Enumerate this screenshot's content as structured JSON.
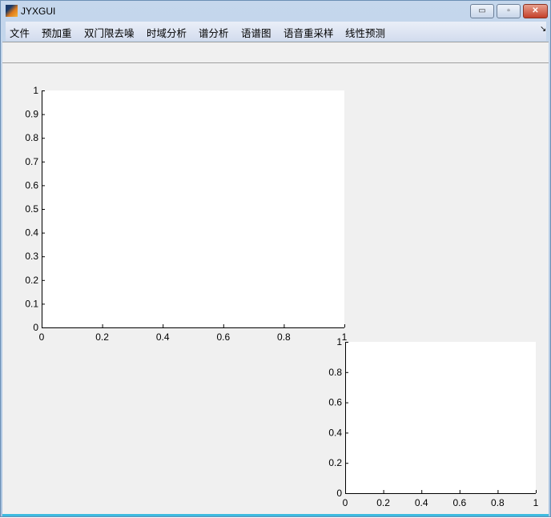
{
  "window": {
    "title": "JYXGUI",
    "minimize": "▭",
    "maximize": "▫",
    "close": "✕"
  },
  "menu": [
    "文件",
    "预加重",
    "双门限去噪",
    "时域分析",
    "谱分析",
    "语谱图",
    "语音重采样",
    "线性预测"
  ],
  "menu_overflow": "↘",
  "chart_data": [
    {
      "type": "line",
      "title": "",
      "xlabel": "",
      "ylabel": "",
      "xlim": [
        0,
        1
      ],
      "ylim": [
        0,
        1
      ],
      "xticks": [
        "0",
        "0.2",
        "0.4",
        "0.6",
        "0.8",
        "1"
      ],
      "yticks": [
        "0",
        "0.1",
        "0.2",
        "0.3",
        "0.4",
        "0.5",
        "0.6",
        "0.7",
        "0.8",
        "0.9",
        "1"
      ],
      "series": []
    },
    {
      "type": "line",
      "title": "",
      "xlabel": "",
      "ylabel": "",
      "xlim": [
        0,
        1
      ],
      "ylim": [
        0,
        1
      ],
      "xticks": [
        "0",
        "0.2",
        "0.4",
        "0.6",
        "0.8",
        "1"
      ],
      "yticks": [
        "0",
        "0.2",
        "0.4",
        "0.6",
        "0.8",
        "1"
      ],
      "series": []
    }
  ]
}
